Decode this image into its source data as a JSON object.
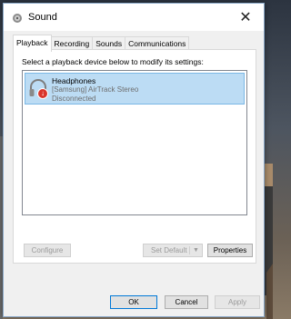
{
  "window": {
    "title": "Sound",
    "close_glyph": "✕"
  },
  "tabs": [
    {
      "label": "Playback",
      "active": true
    },
    {
      "label": "Recording"
    },
    {
      "label": "Sounds"
    },
    {
      "label": "Communications"
    }
  ],
  "panel": {
    "instructions": "Select a playback device below to modify its settings:",
    "devices": [
      {
        "name": "Headphones",
        "description": "[Samsung] AirTrack Stereo",
        "status": "Disconnected",
        "icon": "headphones-icon",
        "badge_icon": "disconnected-arrow-icon",
        "badge_glyph": "↓",
        "selected": true
      }
    ]
  },
  "buttons": {
    "configure": "Configure",
    "set_default": "Set Default",
    "set_default_caret": "▼",
    "properties": "Properties",
    "ok": "OK",
    "cancel": "Cancel",
    "apply": "Apply"
  },
  "colors": {
    "selection_bg": "#bcdcf4",
    "selection_border": "#7ab7e5",
    "default_button_border": "#0078d7",
    "badge_red": "#d9342b"
  }
}
